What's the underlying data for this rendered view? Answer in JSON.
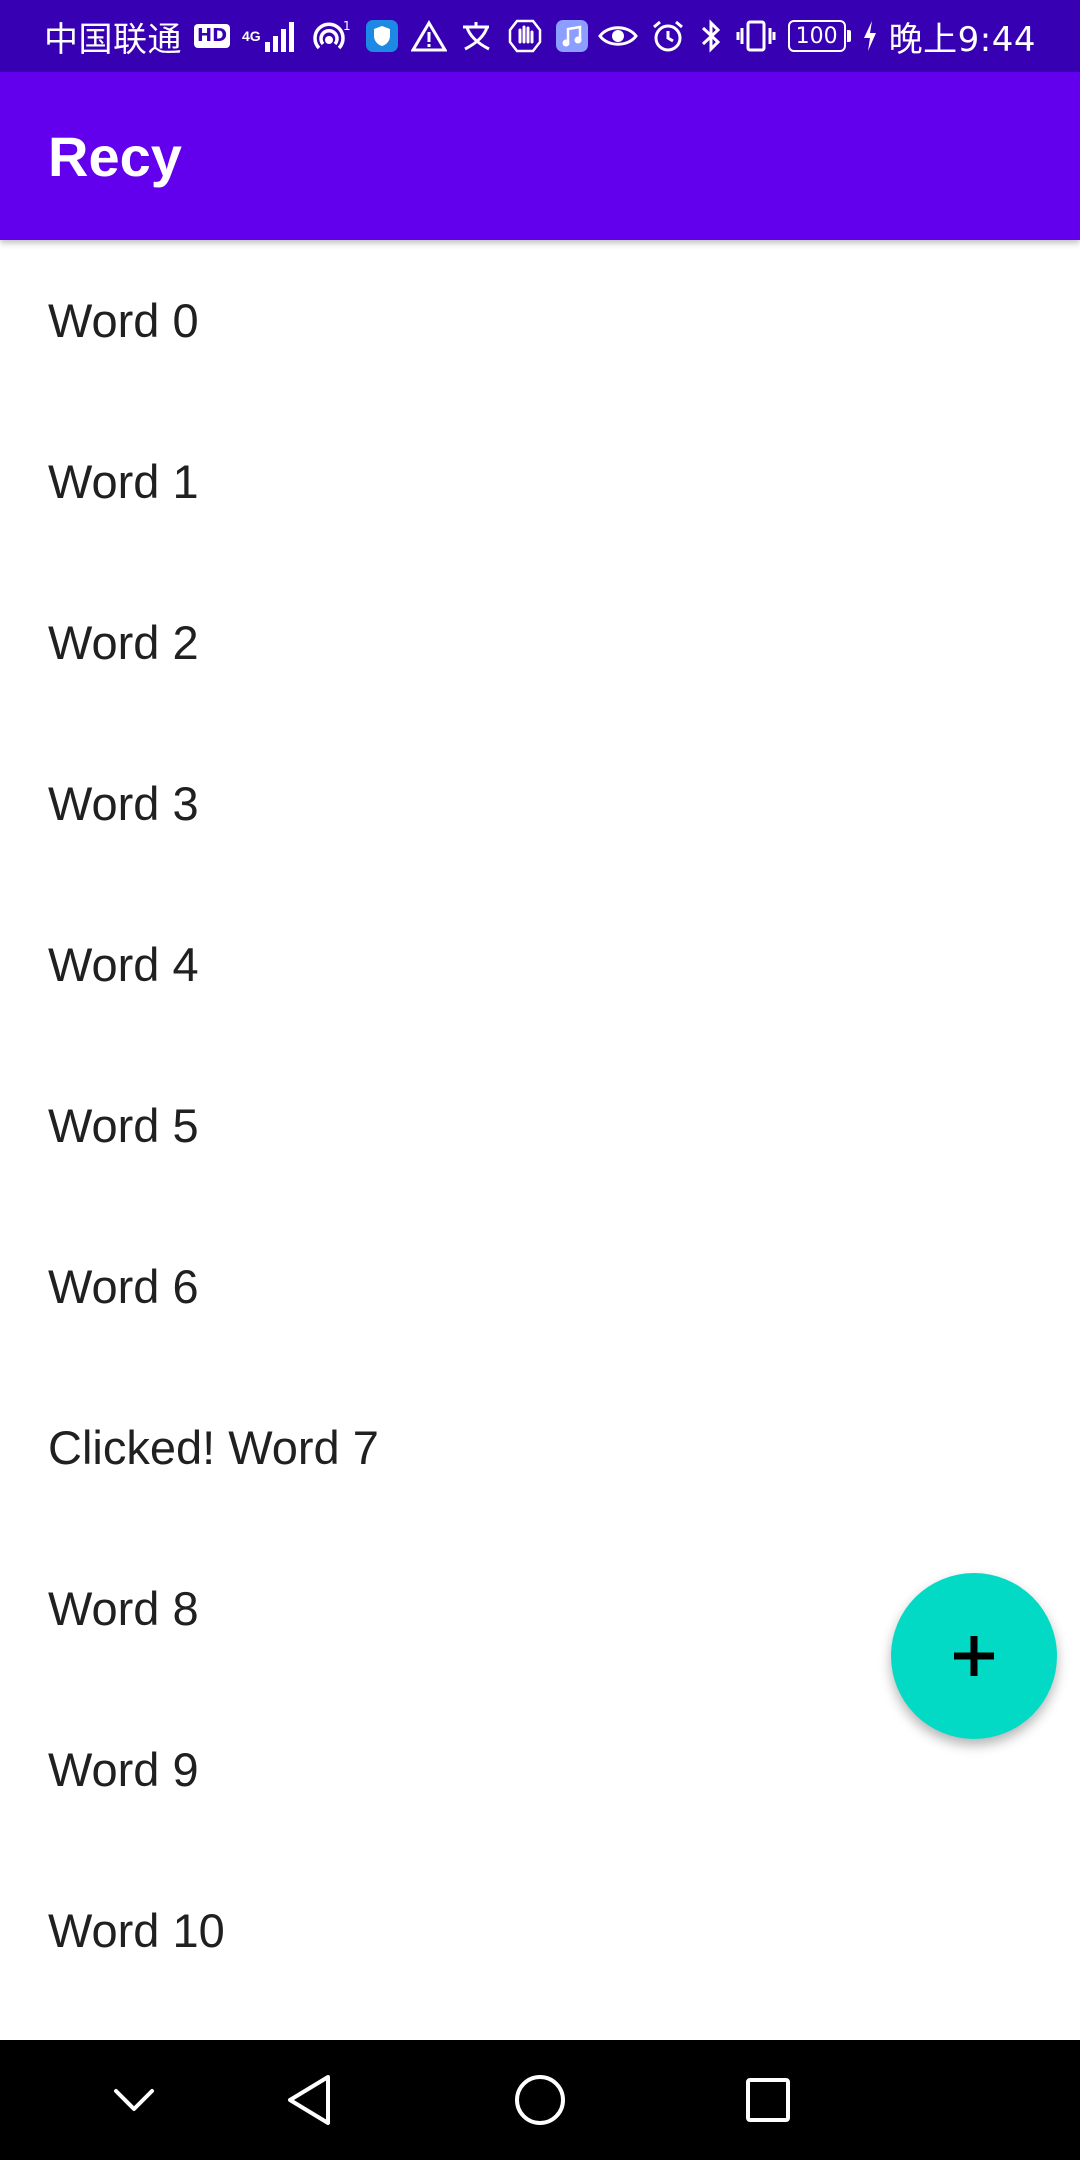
{
  "status_bar": {
    "carrier": "中国联通",
    "hd_badge": "HD",
    "network": "4G",
    "battery_level": "100",
    "time": "晚上9:44",
    "icons": [
      "hd-icon",
      "signal-icon",
      "hotspot-icon",
      "shield-icon",
      "warning-icon",
      "translate-icon",
      "hand-icon",
      "music-icon",
      "eye-icon",
      "alarm-icon",
      "bluetooth-icon",
      "vibrate-icon",
      "battery-icon",
      "charging-icon"
    ]
  },
  "app_bar": {
    "title": "Recy",
    "color": "#6200ee"
  },
  "list": {
    "items": [
      {
        "label": "Word 0"
      },
      {
        "label": "Word 1"
      },
      {
        "label": "Word 2"
      },
      {
        "label": "Word 3"
      },
      {
        "label": "Word 4"
      },
      {
        "label": "Word 5"
      },
      {
        "label": "Word 6"
      },
      {
        "label": "Clicked! Word 7"
      },
      {
        "label": "Word 8"
      },
      {
        "label": "Word 9"
      },
      {
        "label": "Word 10"
      }
    ]
  },
  "fab": {
    "icon": "plus-icon",
    "color": "#03dac5"
  },
  "nav_bar": {
    "buttons": [
      "chevron-down-icon",
      "back-icon",
      "home-icon",
      "recents-icon"
    ]
  }
}
